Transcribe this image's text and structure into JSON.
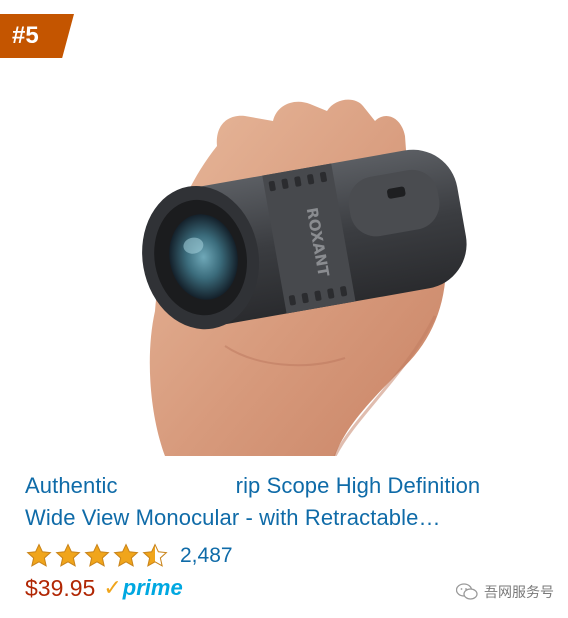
{
  "rank": {
    "label": "#5"
  },
  "product": {
    "title_line1_start": "Authentic",
    "title_line1_end": "rip Scope High Definition",
    "title_line2": "Wide View Monocular - with Retractable…",
    "image_brand_text": "ROXANT",
    "rating": {
      "value": 4.5,
      "max": 5,
      "count": "2,487"
    },
    "price": "$39.95",
    "prime": {
      "check": "✓",
      "label": "prime"
    }
  },
  "watermark": {
    "text": "吾网服务号"
  },
  "colors": {
    "badge": "#c45500",
    "link": "#0f6ba8",
    "price": "#b12704",
    "star": "#f0a51b",
    "prime_blue": "#00a8e1"
  }
}
